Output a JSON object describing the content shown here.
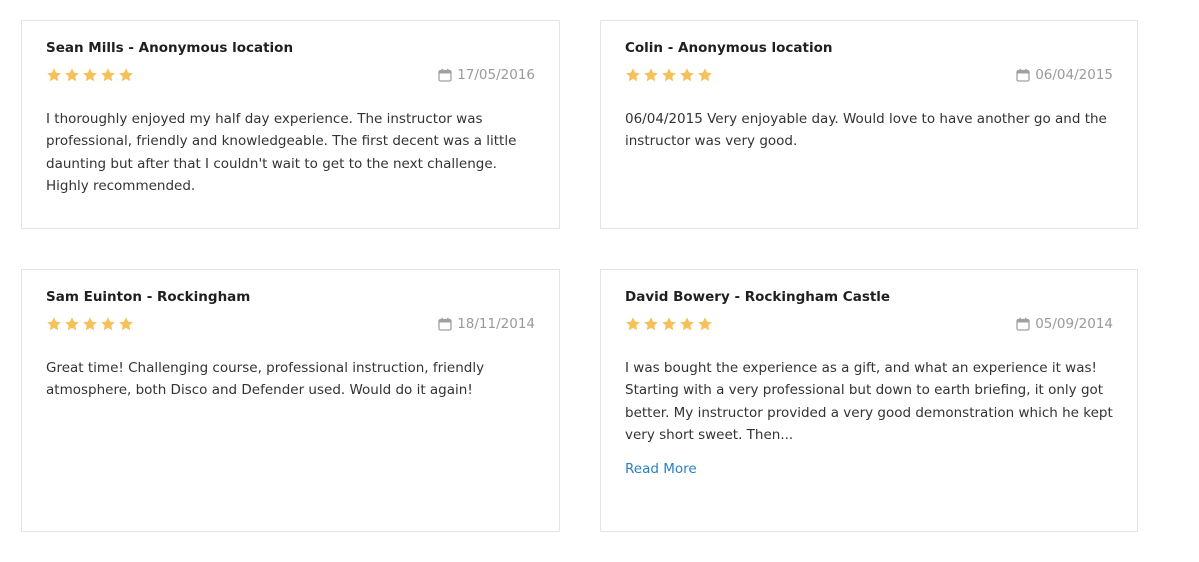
{
  "colors": {
    "star": "#f5c15c",
    "link": "#2a7fc4",
    "date": "#9a9a9a",
    "border": "#e4e4e4"
  },
  "reviews": [
    {
      "author": "Sean Mills - Anonymous location",
      "rating": 5,
      "date": "17/05/2016",
      "text": "I thoroughly enjoyed my half day experience. The instructor was professional, friendly and knowledgeable. The first decent was a little daunting but after that I couldn't wait to get to the next challenge. Highly recommended."
    },
    {
      "author": "Colin - Anonymous location",
      "rating": 5,
      "date": "06/04/2015",
      "text": "06/04/2015 Very enjoyable day. Would love to have another go and the instructor was very good."
    },
    {
      "author": "Sam Euinton - Rockingham",
      "rating": 5,
      "date": "18/11/2014",
      "text": "Great time! Challenging course, professional instruction, friendly atmosphere, both Disco and Defender used. Would do it again!"
    },
    {
      "author": "David Bowery - Rockingham Castle",
      "rating": 5,
      "date": "05/09/2014",
      "text": "I was bought the experience as a gift, and what an experience it was! Starting with a very professional but down to earth briefing, it only got better. My instructor provided a very good demonstration which he kept very short sweet. Then...",
      "read_more": "Read More"
    }
  ]
}
